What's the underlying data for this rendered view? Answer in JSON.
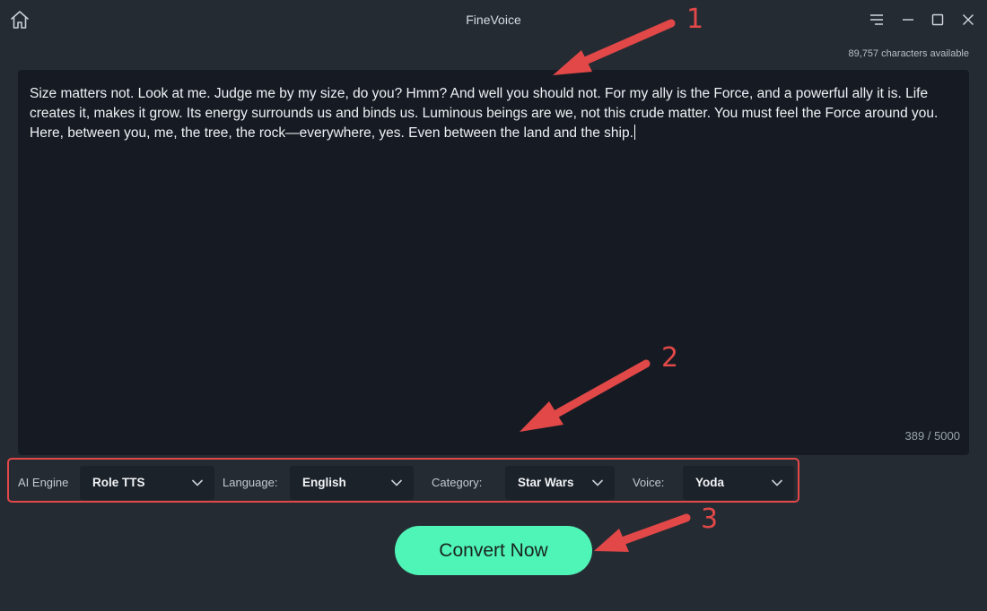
{
  "window": {
    "title": "FineVoice"
  },
  "icons": {
    "home": "home-icon",
    "menu": "hamburger-icon",
    "minimize": "minimize-icon",
    "maximize": "maximize-icon",
    "close": "close-icon",
    "dropdown": "chevron-down-icon"
  },
  "header": {
    "characters_available": "89,757 characters available"
  },
  "editor": {
    "text": "Size matters not. Look at me. Judge me by my size, do you? Hmm? And well you should not. For my ally is the Force, and a powerful ally it is. Life creates it, makes it grow. Its energy surrounds us and binds us. Luminous beings are we, not this crude matter. You must feel the Force around you. Here, between you, me, the tree, the rock—everywhere, yes. Even between the land and the ship.",
    "counter": "389 / 5000"
  },
  "settings": {
    "engine_label": "AI Engine",
    "engine_value": "Role TTS",
    "language_label": "Language:",
    "language_value": "English",
    "category_label": "Category:",
    "category_value": "Star Wars",
    "voice_label": "Voice:",
    "voice_value": "Yoda"
  },
  "actions": {
    "convert_label": "Convert Now"
  },
  "annotations": {
    "step1": "1",
    "step2": "2",
    "step3": "3"
  },
  "colors": {
    "background": "#252b33",
    "editor_bg": "#161b23",
    "accent": "#4ff5b7",
    "annotation_red": "#e24848"
  }
}
